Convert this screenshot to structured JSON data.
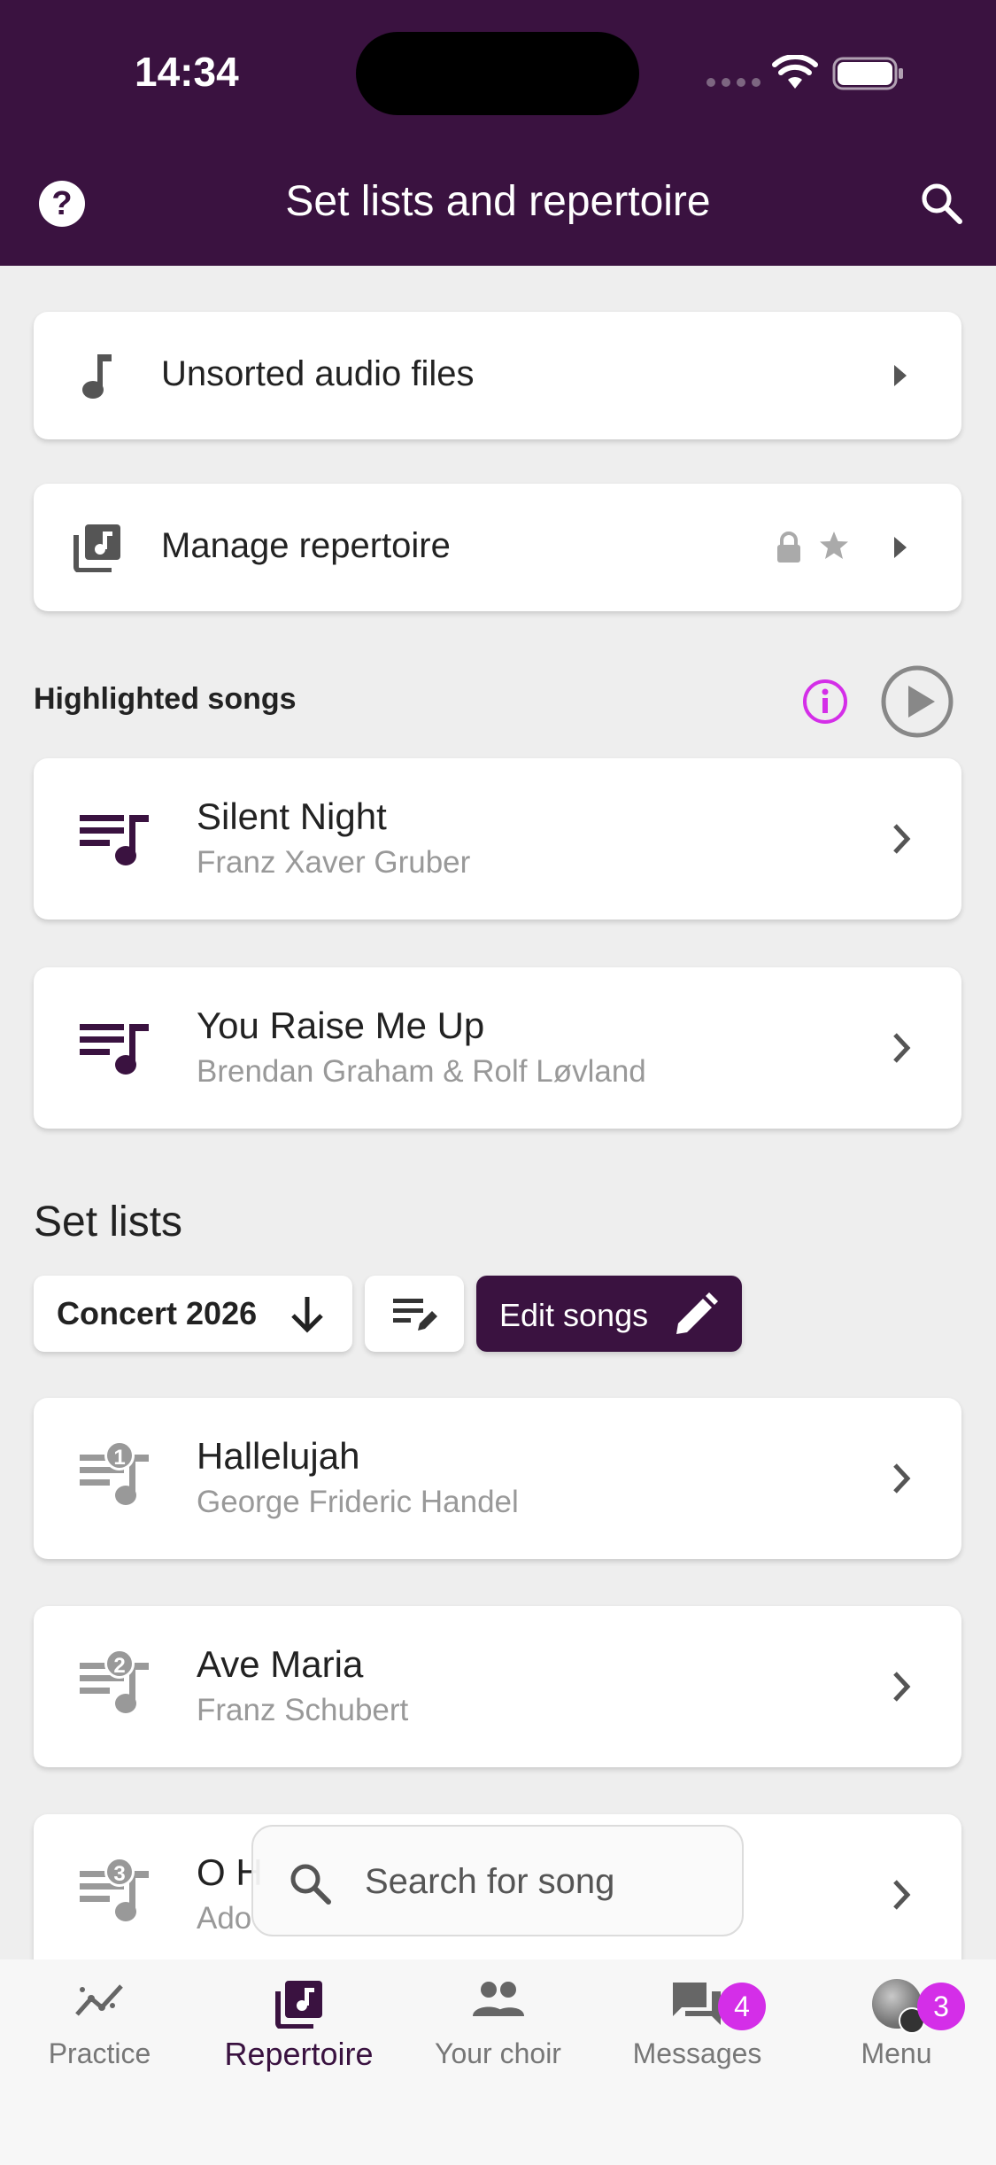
{
  "status_bar": {
    "time": "14:34"
  },
  "header": {
    "title": "Set lists and repertoire",
    "help_icon": "help-circle-icon",
    "search_icon": "search-icon"
  },
  "rows": [
    {
      "label": "Unsorted audio files",
      "icon": "music-note-icon"
    },
    {
      "label": "Manage repertoire",
      "icon": "library-music-icon"
    }
  ],
  "highlighted": {
    "title": "Highlighted songs",
    "songs": [
      {
        "title": "Silent Night",
        "composer": "Franz Xaver Gruber"
      },
      {
        "title": "You Raise Me Up",
        "composer": "Brendan Graham & Rolf Løvland"
      }
    ]
  },
  "setlists": {
    "title": "Set lists",
    "selected": "Concert 2026",
    "edit_songs_label": "Edit songs",
    "songs": [
      {
        "number": "1",
        "title": "Hallelujah",
        "composer": "George Frideric Handel"
      },
      {
        "number": "2",
        "title": "Ave Maria",
        "composer": "Franz Schubert"
      },
      {
        "number": "3",
        "title": "O H",
        "composer": "Ado"
      }
    ]
  },
  "search": {
    "placeholder": "Search for song"
  },
  "nav": {
    "items": [
      {
        "label": "Practice",
        "icon": "practice-chart-icon"
      },
      {
        "label": "Repertoire",
        "icon": "repertoire-icon"
      },
      {
        "label": "Your choir",
        "icon": "people-icon"
      },
      {
        "label": "Messages",
        "icon": "chat-icon",
        "badge": "4"
      },
      {
        "label": "Menu",
        "icon": "avatar",
        "badge": "3"
      }
    ]
  },
  "colors": {
    "brand": "#3a1240",
    "accent": "#d42ee8",
    "background": "#eeeeee"
  }
}
